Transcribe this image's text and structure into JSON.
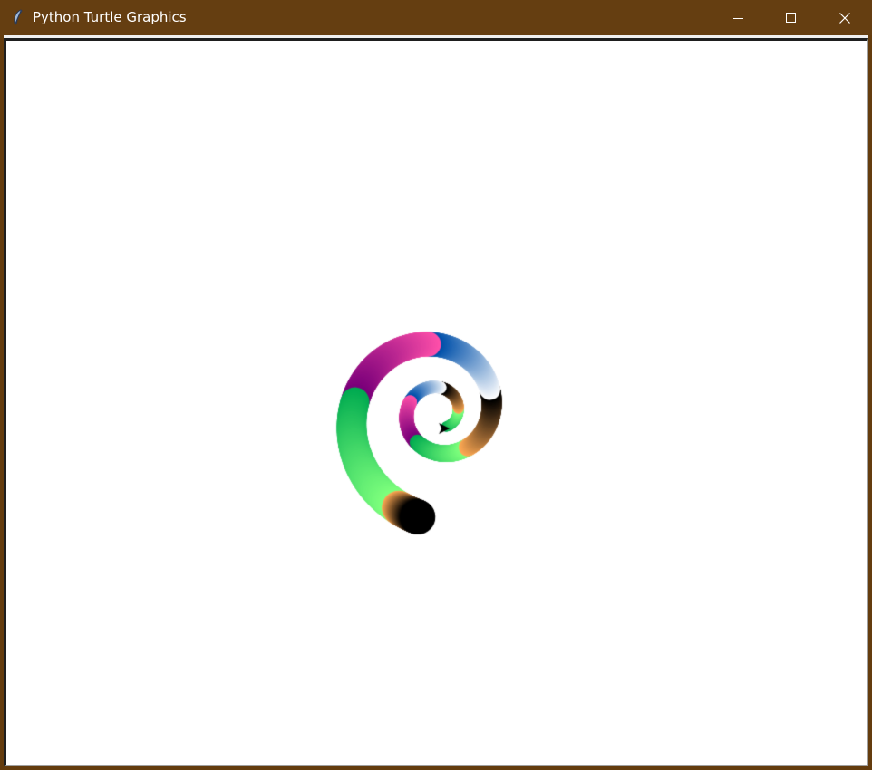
{
  "window": {
    "title": "Python Turtle Graphics",
    "icon": "feather-icon",
    "controls": {
      "minimize": "minimize-icon",
      "maximize": "maximize-icon",
      "close": "close-icon"
    }
  },
  "colors": {
    "titlebar": "#653e11",
    "canvas_background": "#ffffff",
    "gradient_stops": [
      "#ffaa55",
      "#000000",
      "#ffffff",
      "#0050aa",
      "#ff50aa",
      "#7a007a",
      "#00aa50",
      "#7dff7d"
    ]
  },
  "canvas": {
    "background": "white",
    "turtle": {
      "shape": "arrow",
      "color": "#000000"
    }
  }
}
